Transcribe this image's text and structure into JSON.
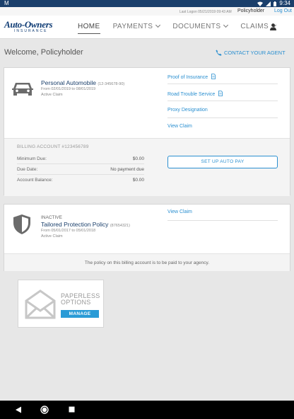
{
  "status_bar": {
    "time": "9:34",
    "left_label": "M"
  },
  "top_strip": {
    "last_login": "Last Logon 05/21/2019 09:43 AM",
    "user_name": "Policyholder",
    "logout": "Log Out"
  },
  "brand": {
    "line1": "Auto-Owners",
    "line2": "INSURANCE"
  },
  "nav": {
    "home": "HOME",
    "payments": "PAYMENTS",
    "documents": "DOCUMENTS",
    "claims": "CLAIMS"
  },
  "welcome": "Welcome, Policyholder",
  "contact_agent": "CONTACT YOUR AGENT",
  "policy1": {
    "title": "Personal Automobile",
    "number": "(12-345678-90)",
    "dates": "From 02/01/2019 to 08/01/2019",
    "status": "Active Claim",
    "links": [
      "Proof of Insurance",
      "Road Trouble Service",
      "Proxy Designation",
      "View Claim"
    ]
  },
  "billing": {
    "header": "BILLING ACCOUNT #123456789",
    "rows": [
      {
        "label": "Minimum Due:",
        "value": "$0.00"
      },
      {
        "label": "Due Date:",
        "value": "No payment due"
      },
      {
        "label": "Account Balance:",
        "value": "$0.00"
      }
    ],
    "autopay": "SET UP AUTO PAY"
  },
  "policy2": {
    "state": "INACTIVE",
    "title": "Tailored Protection Policy",
    "number": "(87654321)",
    "dates": "From 05/01/2017 to 05/01/2018",
    "status": "Active Claim",
    "link": "View Claim",
    "note": "The policy on this billing account is to be paid to your agency."
  },
  "paperless": {
    "line1": "PAPERLESS",
    "line2": "OPTIONS",
    "button": "MANAGE"
  },
  "colors": {
    "brand": "#0d3a73",
    "accent": "#2a8fd0",
    "status_bar": "#1a3f6b"
  }
}
